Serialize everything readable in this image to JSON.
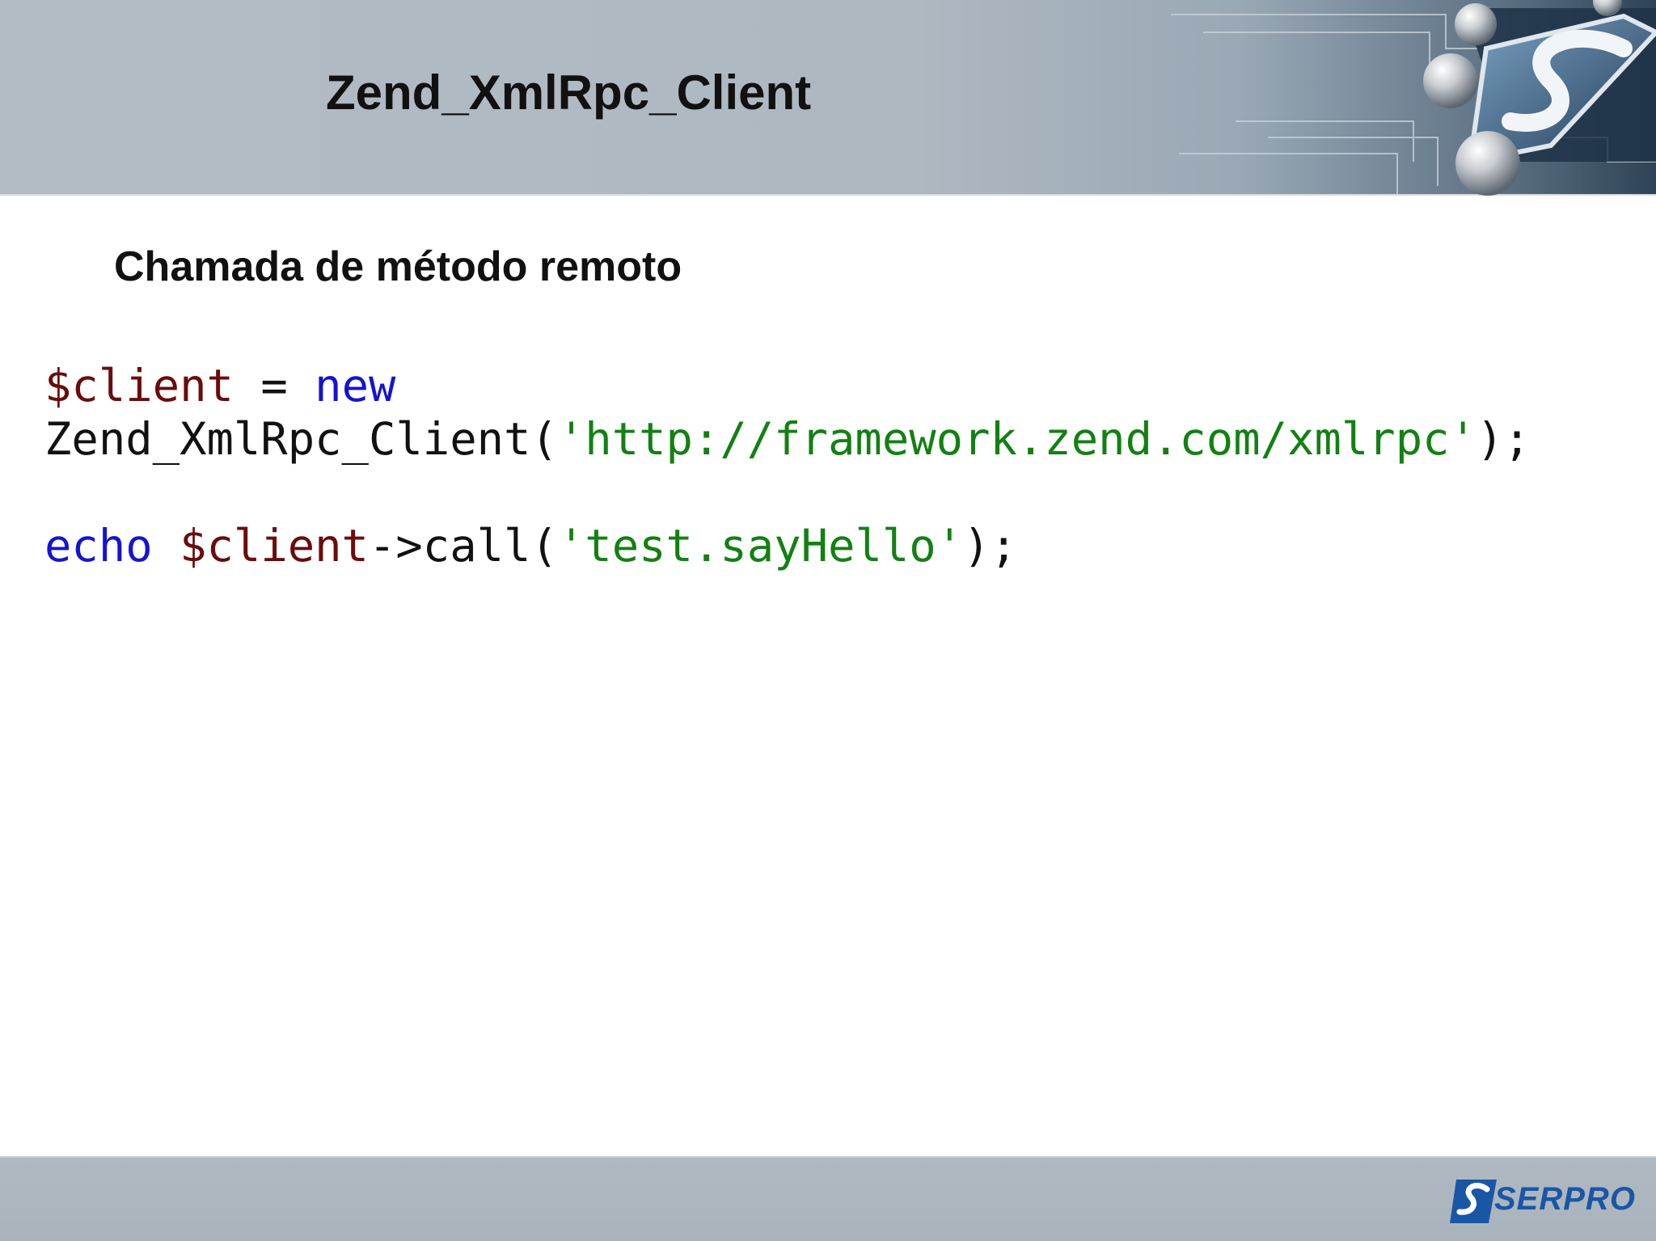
{
  "slide": {
    "title": "Zend_XmlRpc_Client",
    "subtitle": "Chamada de método remoto"
  },
  "code": {
    "line1": {
      "var": "$client",
      "op": " = ",
      "kw": "new"
    },
    "line2": {
      "cls": "Zend_XmlRpc_Client(",
      "str": "'http://framework.zend.com/xmlrpc'",
      "end": ");"
    },
    "line3": {
      "kw": "echo",
      "space": " ",
      "var": "$client",
      "call": "->call(",
      "str": "'test.sayHello'",
      "end": ");"
    }
  },
  "footer": {
    "logo_text": "SERPRO"
  },
  "colors": {
    "variable": "#6b0b0b",
    "keyword": "#1414d2",
    "string": "#138013",
    "logo": "#1a56a6"
  },
  "icons": {
    "header_logo": "serpro-s-emblem-icon",
    "footer_logo": "serpro-logo-icon"
  }
}
